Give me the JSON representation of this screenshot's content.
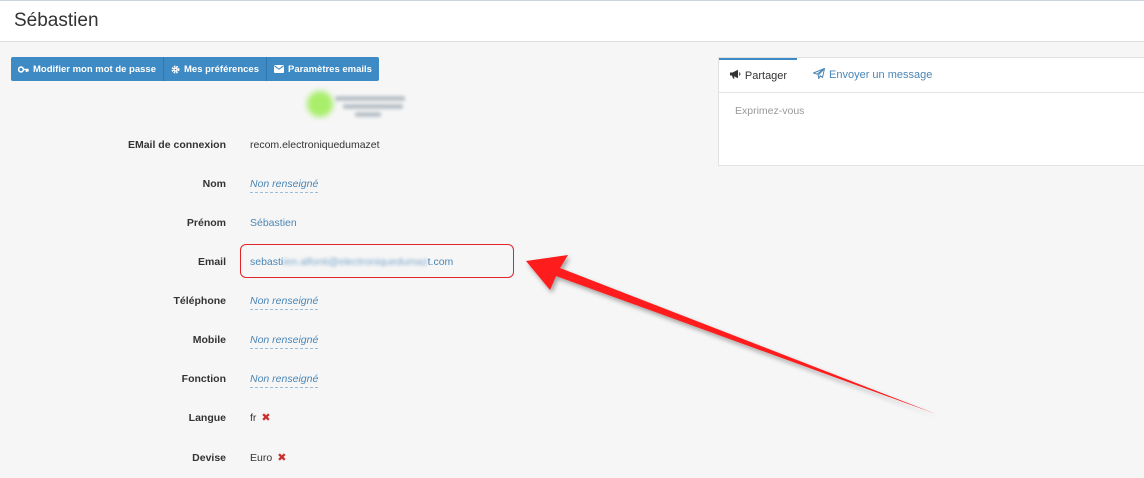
{
  "header": {
    "title": "Sébastien"
  },
  "toolbar": {
    "buttons": [
      {
        "label": "Modifier mon mot de passe",
        "icon": "key-icon"
      },
      {
        "label": "Mes préférences",
        "icon": "gear-icon"
      },
      {
        "label": "Paramètres emails",
        "icon": "envelope-icon"
      }
    ]
  },
  "profile": {
    "fields": [
      {
        "label": "EMail de connexion",
        "value": "recom.electroniquedumazet"
      },
      {
        "label": "Nom",
        "value": "Non renseigné"
      },
      {
        "label": "Prénom",
        "value": "Sébastien"
      },
      {
        "label": "Email",
        "value_start": "sebasti",
        "value_end": "t.com"
      },
      {
        "label": "Téléphone",
        "value": "Non renseigné"
      },
      {
        "label": "Mobile",
        "value": "Non renseigné"
      },
      {
        "label": "Fonction",
        "value": "Non renseigné"
      },
      {
        "label": "Langue",
        "value": "fr"
      },
      {
        "label": "Devise",
        "value": "Euro"
      }
    ]
  },
  "panel": {
    "tabs": [
      {
        "label": "Partager",
        "icon": "megaphone-icon"
      },
      {
        "label": "Envoyer un message",
        "icon": "paper-plane-icon"
      }
    ],
    "placeholder": "Exprimez-vous"
  },
  "colors": {
    "accent": "#3d8ac4",
    "link": "#4a86b6",
    "highlight": "#e0242a"
  }
}
